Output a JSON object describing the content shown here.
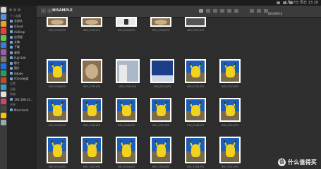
{
  "menubar": {
    "clock": "1月17日 周日 13:28"
  },
  "window": {
    "title": "NISAMPLE"
  },
  "sidebar": {
    "items": [
      {
        "label": "个人收藏"
      },
      {
        "label": "全部文"
      },
      {
        "label": "iCloud"
      },
      {
        "label": "AirDrop"
      },
      {
        "label": "应用程"
      },
      {
        "label": "文稿"
      },
      {
        "label": "下载"
      },
      {
        "label": "桌面"
      },
      {
        "label": "FUJI 500"
      },
      {
        "label": "影片"
      },
      {
        "label": "图片"
      },
      {
        "label": "Adobe"
      },
      {
        "label": "iCloud云盘"
      },
      {
        "label": "位置"
      },
      {
        "label": "设备"
      },
      {
        "label": "网络"
      },
      {
        "label": "192.168.31..."
      },
      {
        "label": "共享"
      },
      {
        "label": "Macintosh"
      }
    ]
  },
  "files": [
    {
      "name": "IMG_5303.JPG",
      "kind": "food"
    },
    {
      "name": "IMG_5304.JPG",
      "kind": "food"
    },
    {
      "name": "IMG_5305.JPG",
      "kind": "bottle"
    },
    {
      "name": "IMG_5306.JPG",
      "kind": "food"
    },
    {
      "name": "IMG_5307.JPG",
      "kind": "dark"
    },
    {
      "name": "IMG_5338.JPG",
      "kind": "pika"
    },
    {
      "name": "IMG_5339.JPG",
      "kind": "food"
    },
    {
      "name": "IMG_5340.JPG",
      "kind": "building"
    },
    {
      "name": "IMG_5341.JPG",
      "kind": "sky"
    },
    {
      "name": "IMG_5342.JPG",
      "kind": "pika"
    },
    {
      "name": "IMG_5343.JPG",
      "kind": "pika"
    },
    {
      "name": "IMG_5344.JPG",
      "kind": "pika"
    },
    {
      "name": "IMG_5345.JPG",
      "kind": "pika"
    },
    {
      "name": "IMG_5346.JPG",
      "kind": "pika"
    },
    {
      "name": "IMG_5347.JPG",
      "kind": "pika"
    },
    {
      "name": "IMG_5348.JPG",
      "kind": "pika"
    },
    {
      "name": "IMG_5351.JPG",
      "kind": "pika"
    },
    {
      "name": "IMG_5352.JPG",
      "kind": "pika"
    },
    {
      "name": "IMG_5353.JPG",
      "kind": "pika"
    },
    {
      "name": "IMG_5354.JPG",
      "kind": "pika"
    },
    {
      "name": "IMG_5355.JPG",
      "kind": "pika"
    },
    {
      "name": "IMG_5356.JPG",
      "kind": "pika"
    },
    {
      "name": "IMG_5357.JPG",
      "kind": "pika"
    },
    {
      "name": "IMG_5358.JPG",
      "kind": "pika"
    },
    {
      "name": "IMG_5359.JPG",
      "kind": "pika"
    },
    {
      "name": "IMG_5360.JPG",
      "kind": "blank"
    },
    {
      "name": "IMG_5361.HEIC",
      "kind": "room"
    },
    {
      "name": "IMG_5362.PNG",
      "kind": "phone"
    },
    {
      "name": "IMG_5374.JPG",
      "kind": "park"
    },
    {
      "name": "IMG_5376.JPG",
      "kind": "park"
    },
    {
      "name": "IMG_5377.JPG",
      "kind": "park"
    },
    {
      "name": "IMG_5378.JPG",
      "kind": "park"
    }
  ],
  "watermark": {
    "badge": "值",
    "text": "什么值得买"
  },
  "colors": {
    "pika": "#f2d21c",
    "sky": "#1b5fb8",
    "accent": "#2f7be0"
  }
}
